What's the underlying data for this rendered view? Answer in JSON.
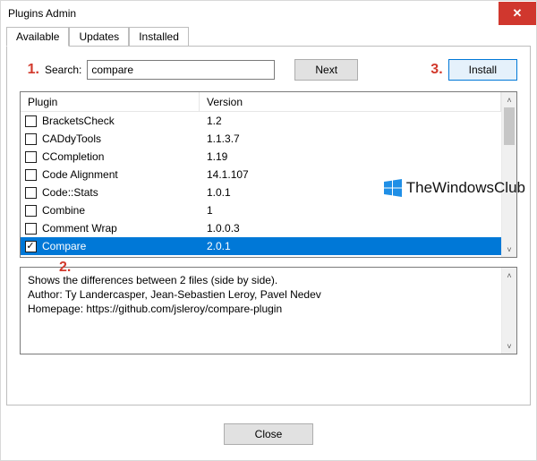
{
  "window": {
    "title": "Plugins Admin"
  },
  "tabs": {
    "available": "Available",
    "updates": "Updates",
    "installed": "Installed"
  },
  "search": {
    "label": "Search:",
    "value": "compare",
    "next_label": "Next",
    "install_label": "Install"
  },
  "callouts": {
    "one": "1.",
    "two": "2.",
    "three": "3."
  },
  "columns": {
    "plugin": "Plugin",
    "version": "Version"
  },
  "plugins": [
    {
      "name": "BracketsCheck",
      "version": "1.2",
      "checked": false,
      "selected": false
    },
    {
      "name": "CADdyTools",
      "version": "1.1.3.7",
      "checked": false,
      "selected": false
    },
    {
      "name": "CCompletion",
      "version": "1.19",
      "checked": false,
      "selected": false
    },
    {
      "name": "Code Alignment",
      "version": "14.1.107",
      "checked": false,
      "selected": false
    },
    {
      "name": "Code::Stats",
      "version": "1.0.1",
      "checked": false,
      "selected": false
    },
    {
      "name": "Combine",
      "version": "1",
      "checked": false,
      "selected": false
    },
    {
      "name": "Comment Wrap",
      "version": "1.0.0.3",
      "checked": false,
      "selected": false
    },
    {
      "name": "Compare",
      "version": "2.0.1",
      "checked": true,
      "selected": true
    }
  ],
  "details": {
    "text": "Shows the differences between 2 files (side by side).\nAuthor: Ty Landercasper, Jean-Sebastien Leroy, Pavel Nedev\nHomepage: https://github.com/jsleroy/compare-plugin"
  },
  "close_label": "Close",
  "watermark": "TheWindowsClub"
}
